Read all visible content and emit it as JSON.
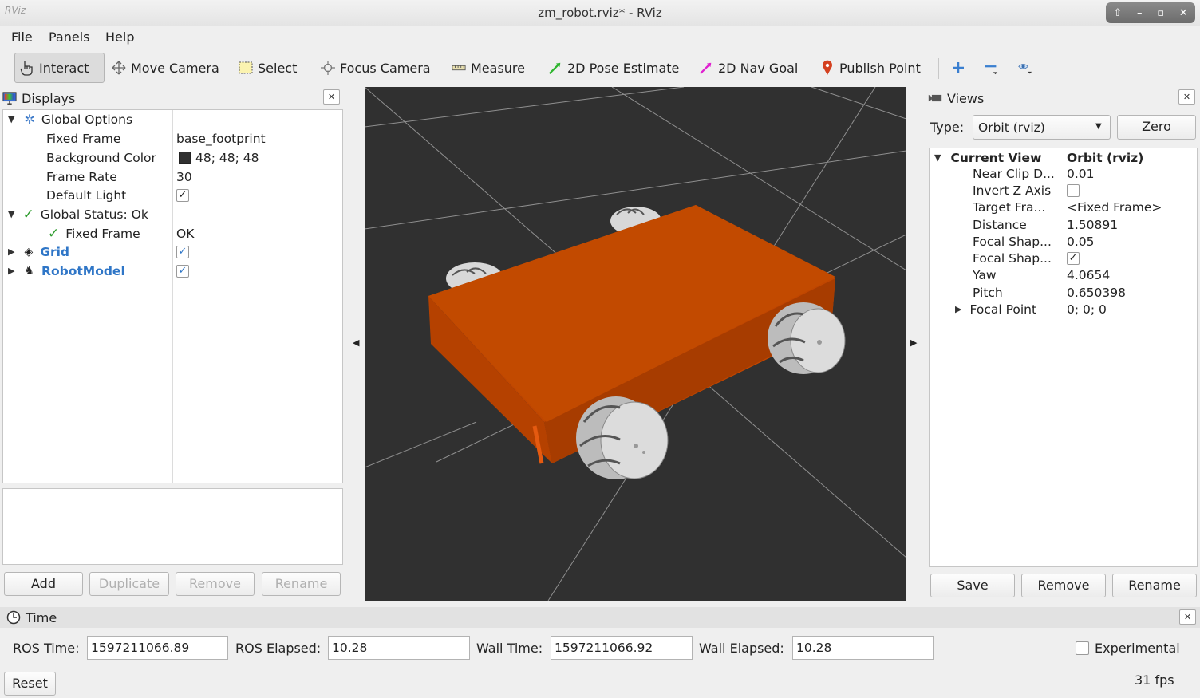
{
  "window": {
    "title": "zm_robot.rviz* - RViz",
    "app_icon": "RViz"
  },
  "menu": {
    "file": "File",
    "panels": "Panels",
    "help": "Help"
  },
  "toolbar": {
    "interact": "Interact",
    "move_camera": "Move Camera",
    "select": "Select",
    "focus_camera": "Focus Camera",
    "measure": "Measure",
    "pose_estimate": "2D Pose Estimate",
    "nav_goal": "2D Nav Goal",
    "publish_point": "Publish Point"
  },
  "displays": {
    "title": "Displays",
    "global_options": "Global Options",
    "fixed_frame_label": "Fixed Frame",
    "fixed_frame_value": "base_footprint",
    "background_color_label": "Background Color",
    "background_color_value": "48; 48; 48",
    "background_color_swatch": "#303030",
    "frame_rate_label": "Frame Rate",
    "frame_rate_value": "30",
    "default_light_label": "Default Light",
    "global_status": "Global Status: Ok",
    "status_fixed_frame_label": "Fixed Frame",
    "status_fixed_frame_value": "OK",
    "grid": "Grid",
    "robot_model": "RobotModel",
    "buttons": {
      "add": "Add",
      "duplicate": "Duplicate",
      "remove": "Remove",
      "rename": "Rename"
    }
  },
  "views": {
    "title": "Views",
    "type_label": "Type:",
    "type_value": "Orbit (rviz)",
    "zero": "Zero",
    "current_view_label": "Current View",
    "current_view_value": "Orbit (rviz)",
    "props": [
      {
        "label": "Near Clip D...",
        "value": "0.01"
      },
      {
        "label": "Invert Z Axis",
        "value": ""
      },
      {
        "label": "Target Fra...",
        "value": "<Fixed Frame>"
      },
      {
        "label": "Distance",
        "value": "1.50891"
      },
      {
        "label": "Focal Shap...",
        "value": "0.05"
      },
      {
        "label": "Focal Shap...",
        "value": ""
      },
      {
        "label": "Yaw",
        "value": "4.0654"
      },
      {
        "label": "Pitch",
        "value": "0.650398"
      },
      {
        "label": "Focal Point",
        "value": "0; 0; 0"
      }
    ],
    "buttons": {
      "save": "Save",
      "remove": "Remove",
      "rename": "Rename"
    }
  },
  "time": {
    "title": "Time",
    "ros_time_label": "ROS Time:",
    "ros_time_value": "1597211066.89",
    "ros_elapsed_label": "ROS Elapsed:",
    "ros_elapsed_value": "10.28",
    "wall_time_label": "Wall Time:",
    "wall_time_value": "1597211066.92",
    "wall_elapsed_label": "Wall Elapsed:",
    "wall_elapsed_value": "10.28",
    "experimental": "Experimental",
    "reset": "Reset",
    "fps": "31 fps"
  },
  "colors": {
    "viewport_bg": "#303030",
    "robot_body": "#c24a00",
    "accent_blue": "#2f76c7"
  }
}
